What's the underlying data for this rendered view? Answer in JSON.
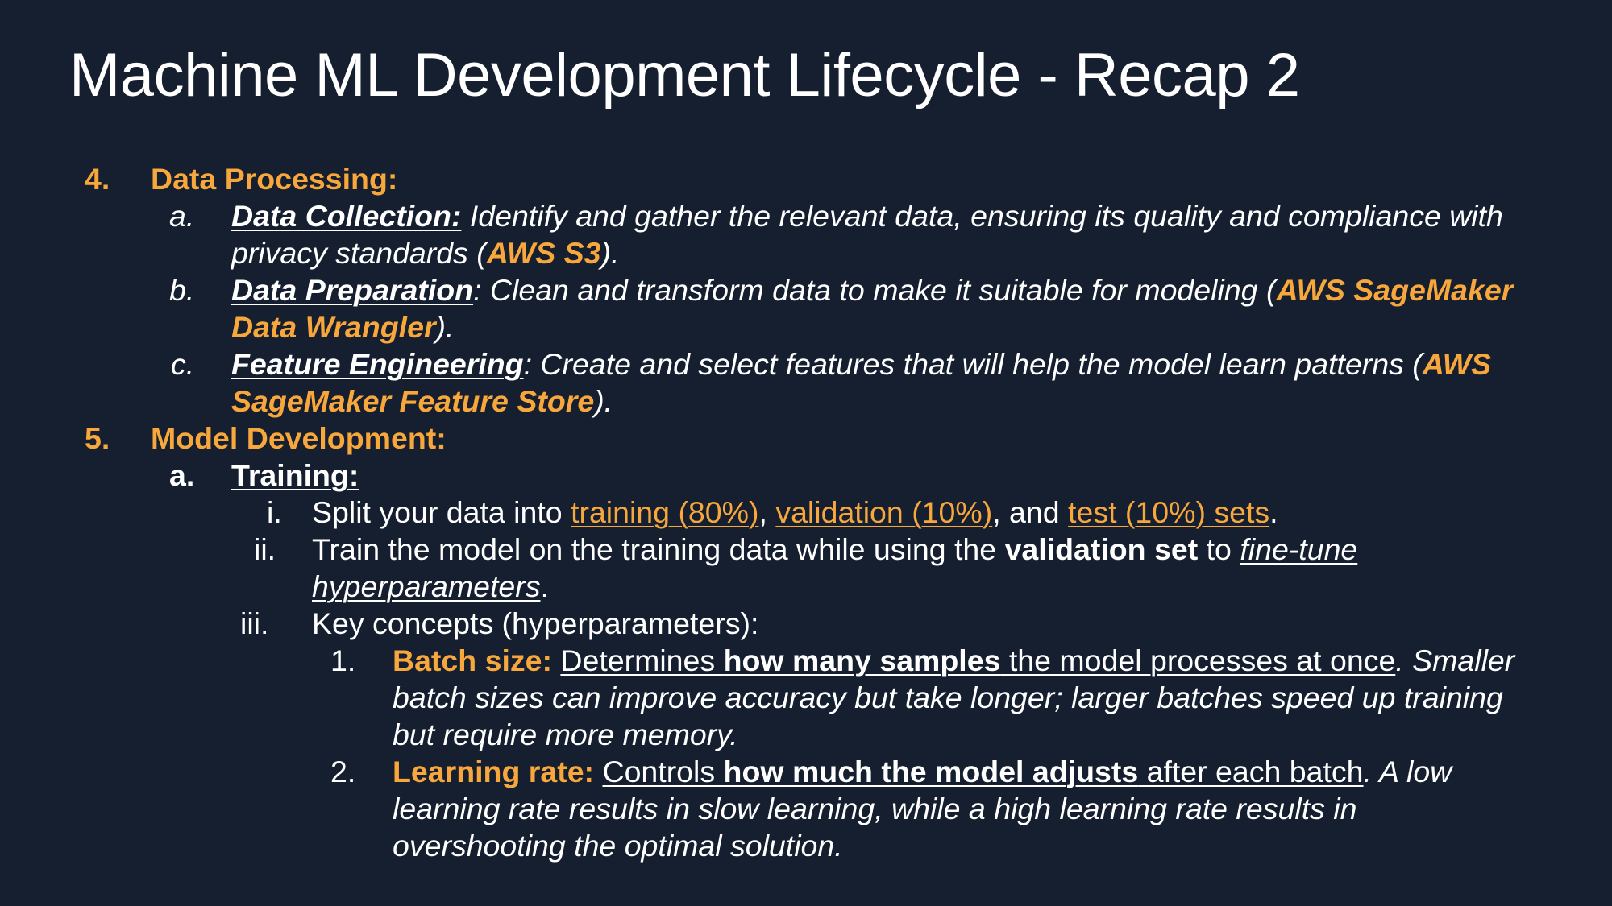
{
  "title": "Machine ML Development Lifecycle - Recap 2",
  "colors": {
    "background": "#151f2f",
    "text": "#ffffff",
    "accent": "#f7a73b"
  },
  "sections": [
    {
      "number": "4.",
      "heading": "Data Processing:",
      "items": [
        {
          "marker": "a.",
          "term": "Data Collection:",
          "line1": " Identify and gather the relevant data, ensuring its quality and compliance with",
          "line2_pre": "privacy standards (",
          "service": "AWS S3",
          "line2_post": ")."
        },
        {
          "marker": "b.",
          "term": "Data Preparation",
          "line1_text": ": Clean and transform data to make it suitable for modeling (",
          "service_part1": "AWS SageMaker",
          "service_part2": "Data Wrangler",
          "line2_post": ")."
        },
        {
          "marker": "c.",
          "term": "Feature Engineering",
          "line1_text": ": Create and select features that will help the model learn patterns (",
          "service_part1": "AWS",
          "service_part2": "SageMaker Feature Store",
          "line2_post": ")."
        }
      ]
    },
    {
      "number": "5.",
      "heading": "Model Development:",
      "sub_marker": "a.",
      "sub_heading": "Training:",
      "steps": [
        {
          "marker": "i.",
          "text_pre": "Split your data into ",
          "split1": "training (80%)",
          "sep1": ", ",
          "split2": "validation (10%)",
          "sep2": ", and ",
          "split3": "test (10%) sets",
          "end": "."
        },
        {
          "marker": "ii.",
          "text_pre": "Train the model on the training data while using the ",
          "bold": "validation set",
          "mid": " to ",
          "link1": "fine-tune",
          "link2": "hyperparameters",
          "end": "."
        },
        {
          "marker": "iii.",
          "text": "Key concepts (hyperparameters):"
        }
      ],
      "concepts": [
        {
          "marker": "1.",
          "name": "Batch size:",
          "d1": "Determines ",
          "d_bold": "how many samples",
          "d2": " the model processes at once",
          "note1": ". Smaller",
          "note2": "batch sizes can improve accuracy but take longer; larger batches speed up training",
          "note3": "but require more memory."
        },
        {
          "marker": "2.",
          "name": "Learning rate:",
          "d1": "Controls ",
          "d_bold": "how much the model adjusts",
          "d2": " after each batch",
          "note1": ". A low",
          "note2": "learning rate results in slow learning, while a high learning rate results in",
          "note3": "overshooting the optimal solution."
        }
      ]
    }
  ]
}
